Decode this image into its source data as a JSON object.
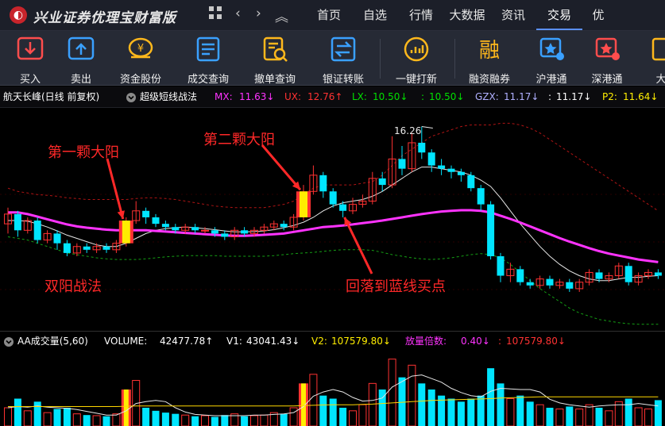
{
  "app": {
    "title": "兴业证券优理宝财富版"
  },
  "nav": {
    "grid_icon": "grid-icon",
    "back": "‹",
    "forward": "›",
    "collapse": "︽"
  },
  "tabs": [
    {
      "label": "首页"
    },
    {
      "label": "自选"
    },
    {
      "label": "行情"
    },
    {
      "label": "大数据"
    },
    {
      "label": "资讯"
    },
    {
      "label": "交易"
    },
    {
      "label": "优"
    }
  ],
  "active_tab": "交易",
  "toolbar": [
    {
      "label": "买入",
      "icon": "buy-icon",
      "color": "#ff4d4d"
    },
    {
      "label": "卖出",
      "icon": "sell-icon",
      "color": "#3aa0ff"
    },
    {
      "label": "资金股份",
      "icon": "fund-icon",
      "color": "#ffb81c"
    },
    {
      "label": "成交查询",
      "icon": "deal-query-icon",
      "color": "#3aa0ff"
    },
    {
      "label": "撤单查询",
      "icon": "cancel-query-icon",
      "color": "#ffb81c"
    },
    {
      "label": "银证转账",
      "icon": "transfer-icon",
      "color": "#3aa0ff"
    },
    {
      "label": "一键打新",
      "icon": "ipo-icon",
      "color": "#ffb81c"
    },
    {
      "label": "融资融券",
      "icon": "margin-icon",
      "color": "#ffb81c"
    },
    {
      "label": "沪港通",
      "icon": "sh-hk-icon",
      "color": "#3aa0ff"
    },
    {
      "label": "深港通",
      "icon": "sz-hk-icon",
      "color": "#ff4d4d"
    },
    {
      "label": "大",
      "icon": "more-icon",
      "color": "#ffb81c"
    }
  ],
  "price_info": {
    "stock": "航天长峰(日线 前复权)",
    "indicator": "超级短线战法",
    "mx_label": "MX: ",
    "mx_value": "11.63↓",
    "ux_label": "UX: ",
    "ux_value": "12.76↑",
    "lx_label": "LX: ",
    "lx_value": "10.50↓",
    "blank1_label": ": ",
    "blank1_value": "10.50↓",
    "gzx_label": "GZX: ",
    "gzx_value": "11.17↓",
    "blank2_label": ": ",
    "blank2_value": "11.17↓",
    "p2_label": "P2: ",
    "p2_value": "11.64↓"
  },
  "volume_info": {
    "name": "AA成交量(5,60)",
    "volume_label": "VOLUME: ",
    "volume_value": "42477.78↑",
    "v1_label": "V1: ",
    "v1_value": "43041.43↓",
    "v2_label": "V2: ",
    "v2_value": "107579.80↓",
    "ratio_label": "放量倍数: ",
    "ratio_value": "0.40↓",
    "blank_label": ": ",
    "blank_value": "107579.80↓"
  },
  "annotations": {
    "first": "第一颗大阳",
    "second": "第二颗大阳",
    "method": "双阳战法",
    "pullback": "回落到蓝线买点",
    "high_price": "16.26"
  },
  "colors": {
    "up": "#ff3232",
    "down": "#00e5ff",
    "highlight": "#ffee00",
    "mid_line": "#ff33ff",
    "upper_band": "#b01414",
    "lower_band": "#14a014",
    "white_line": "#e6e6e6",
    "v2_line": "#ffd700",
    "annotation": "#ff2828"
  },
  "chart_data": {
    "type": "candlestick",
    "bars": [
      {
        "o": 11.8,
        "c": 12.1,
        "h": 12.3,
        "l": 11.5,
        "v": 30000
      },
      {
        "o": 12.1,
        "c": 11.6,
        "h": 12.2,
        "l": 11.4,
        "v": 45000
      },
      {
        "o": 11.6,
        "c": 11.9,
        "h": 12.0,
        "l": 11.5,
        "v": 25000
      },
      {
        "o": 11.9,
        "c": 11.3,
        "h": 12.0,
        "l": 11.2,
        "v": 40000
      },
      {
        "o": 11.3,
        "c": 11.5,
        "h": 11.6,
        "l": 11.2,
        "v": 22000
      },
      {
        "o": 11.5,
        "c": 11.2,
        "h": 11.6,
        "l": 11.0,
        "v": 28000
      },
      {
        "o": 11.2,
        "c": 10.9,
        "h": 11.3,
        "l": 10.8,
        "v": 30000
      },
      {
        "o": 10.9,
        "c": 11.1,
        "h": 11.2,
        "l": 10.8,
        "v": 20000
      },
      {
        "o": 11.1,
        "c": 11.0,
        "h": 11.2,
        "l": 10.9,
        "v": 18000
      },
      {
        "o": 11.0,
        "c": 11.1,
        "h": 11.2,
        "l": 10.9,
        "v": 17000
      },
      {
        "o": 11.1,
        "c": 11.0,
        "h": 11.2,
        "l": 10.9,
        "v": 16000
      },
      {
        "o": 11.0,
        "c": 11.2,
        "h": 11.3,
        "l": 10.9,
        "v": 20000
      },
      {
        "o": 11.2,
        "c": 11.9,
        "h": 12.0,
        "l": 11.1,
        "v": 60000,
        "mark": true
      },
      {
        "o": 11.9,
        "c": 12.2,
        "h": 12.5,
        "l": 11.8,
        "v": 75000
      },
      {
        "o": 12.2,
        "c": 12.0,
        "h": 12.3,
        "l": 11.8,
        "v": 30000
      },
      {
        "o": 12.0,
        "c": 11.8,
        "h": 12.1,
        "l": 11.7,
        "v": 25000
      },
      {
        "o": 11.8,
        "c": 11.7,
        "h": 11.9,
        "l": 11.6,
        "v": 22000
      },
      {
        "o": 11.7,
        "c": 11.6,
        "h": 11.8,
        "l": 11.5,
        "v": 20000
      },
      {
        "o": 11.6,
        "c": 11.7,
        "h": 11.8,
        "l": 11.5,
        "v": 18000
      },
      {
        "o": 11.7,
        "c": 11.6,
        "h": 11.8,
        "l": 11.5,
        "v": 16000
      },
      {
        "o": 11.6,
        "c": 11.6,
        "h": 11.7,
        "l": 11.5,
        "v": 17000
      },
      {
        "o": 11.6,
        "c": 11.5,
        "h": 11.7,
        "l": 11.4,
        "v": 15000
      },
      {
        "o": 11.5,
        "c": 11.4,
        "h": 11.6,
        "l": 11.3,
        "v": 18000
      },
      {
        "o": 11.4,
        "c": 11.6,
        "h": 11.7,
        "l": 11.3,
        "v": 20000
      },
      {
        "o": 11.6,
        "c": 11.5,
        "h": 11.7,
        "l": 11.4,
        "v": 16000
      },
      {
        "o": 11.5,
        "c": 11.6,
        "h": 11.7,
        "l": 11.4,
        "v": 17000
      },
      {
        "o": 11.6,
        "c": 11.7,
        "h": 11.8,
        "l": 11.5,
        "v": 18000
      },
      {
        "o": 11.7,
        "c": 11.8,
        "h": 11.9,
        "l": 11.6,
        "v": 22000
      },
      {
        "o": 11.8,
        "c": 11.7,
        "h": 11.9,
        "l": 11.6,
        "v": 20000
      },
      {
        "o": 11.7,
        "c": 12.0,
        "h": 12.1,
        "l": 11.6,
        "v": 30000
      },
      {
        "o": 12.0,
        "c": 12.8,
        "h": 13.0,
        "l": 11.9,
        "v": 70000,
        "mark": true
      },
      {
        "o": 12.8,
        "c": 13.3,
        "h": 13.6,
        "l": 12.7,
        "v": 85000
      },
      {
        "o": 13.3,
        "c": 12.8,
        "h": 13.4,
        "l": 12.6,
        "v": 50000
      },
      {
        "o": 12.8,
        "c": 12.4,
        "h": 12.9,
        "l": 12.3,
        "v": 45000
      },
      {
        "o": 12.4,
        "c": 12.2,
        "h": 12.5,
        "l": 12.0,
        "v": 30000
      },
      {
        "o": 12.2,
        "c": 12.4,
        "h": 12.6,
        "l": 12.1,
        "v": 25000
      },
      {
        "o": 12.4,
        "c": 12.5,
        "h": 12.7,
        "l": 12.3,
        "v": 35000
      },
      {
        "o": 12.5,
        "c": 13.2,
        "h": 13.4,
        "l": 12.4,
        "v": 70000
      },
      {
        "o": 13.2,
        "c": 13.0,
        "h": 13.4,
        "l": 12.8,
        "v": 60000
      },
      {
        "o": 13.0,
        "c": 13.8,
        "h": 14.5,
        "l": 12.9,
        "v": 110000
      },
      {
        "o": 13.8,
        "c": 13.5,
        "h": 14.2,
        "l": 13.3,
        "v": 80000
      },
      {
        "o": 13.5,
        "c": 14.3,
        "h": 14.6,
        "l": 13.4,
        "v": 100000
      },
      {
        "o": 14.3,
        "c": 14.0,
        "h": 14.8,
        "l": 13.8,
        "v": 70000
      },
      {
        "o": 14.0,
        "c": 13.6,
        "h": 14.1,
        "l": 13.4,
        "v": 60000
      },
      {
        "o": 13.6,
        "c": 13.5,
        "h": 13.8,
        "l": 13.3,
        "v": 50000
      },
      {
        "o": 13.5,
        "c": 13.4,
        "h": 13.6,
        "l": 13.2,
        "v": 45000
      },
      {
        "o": 13.4,
        "c": 13.3,
        "h": 13.5,
        "l": 13.1,
        "v": 40000
      },
      {
        "o": 13.3,
        "c": 12.9,
        "h": 13.4,
        "l": 12.8,
        "v": 45000
      },
      {
        "o": 12.9,
        "c": 12.4,
        "h": 13.0,
        "l": 12.2,
        "v": 50000
      },
      {
        "o": 12.4,
        "c": 10.8,
        "h": 12.5,
        "l": 10.7,
        "v": 95000
      },
      {
        "o": 10.8,
        "c": 10.2,
        "h": 10.9,
        "l": 10.0,
        "v": 70000
      },
      {
        "o": 10.2,
        "c": 10.4,
        "h": 10.6,
        "l": 10.0,
        "v": 45000
      },
      {
        "o": 10.4,
        "c": 10.0,
        "h": 10.5,
        "l": 9.9,
        "v": 50000
      },
      {
        "o": 10.0,
        "c": 9.9,
        "h": 10.1,
        "l": 9.8,
        "v": 40000
      },
      {
        "o": 9.9,
        "c": 10.1,
        "h": 10.2,
        "l": 9.8,
        "v": 35000
      },
      {
        "o": 10.1,
        "c": 9.9,
        "h": 10.2,
        "l": 9.8,
        "v": 30000
      },
      {
        "o": 9.9,
        "c": 10.0,
        "h": 10.1,
        "l": 9.8,
        "v": 28000
      },
      {
        "o": 10.0,
        "c": 9.8,
        "h": 10.1,
        "l": 9.7,
        "v": 32000
      },
      {
        "o": 9.8,
        "c": 10.0,
        "h": 10.1,
        "l": 9.7,
        "v": 28000
      },
      {
        "o": 10.0,
        "c": 10.3,
        "h": 10.4,
        "l": 9.9,
        "v": 35000
      },
      {
        "o": 10.3,
        "c": 10.1,
        "h": 10.4,
        "l": 10.0,
        "v": 30000
      },
      {
        "o": 10.1,
        "c": 10.2,
        "h": 10.3,
        "l": 10.0,
        "v": 25000
      },
      {
        "o": 10.2,
        "c": 10.5,
        "h": 10.6,
        "l": 10.1,
        "v": 40000
      },
      {
        "o": 10.5,
        "c": 10.0,
        "h": 10.6,
        "l": 9.9,
        "v": 45000
      },
      {
        "o": 10.0,
        "c": 10.2,
        "h": 10.3,
        "l": 9.9,
        "v": 30000
      },
      {
        "o": 10.2,
        "c": 10.3,
        "h": 10.4,
        "l": 10.1,
        "v": 28000
      },
      {
        "o": 10.3,
        "c": 10.2,
        "h": 10.4,
        "l": 10.1,
        "v": 42478
      }
    ],
    "mid_line": [
      12.15,
      12.15,
      12.1,
      12.02,
      11.94,
      11.86,
      11.78,
      11.72,
      11.68,
      11.65,
      11.62,
      11.6,
      11.6,
      11.6,
      11.6,
      11.58,
      11.56,
      11.54,
      11.52,
      11.5,
      11.48,
      11.46,
      11.44,
      11.43,
      11.43,
      11.44,
      11.46,
      11.48,
      11.5,
      11.55,
      11.6,
      11.65,
      11.7,
      11.72,
      11.75,
      11.78,
      11.82,
      11.86,
      11.9,
      11.95,
      12.0,
      12.05,
      12.1,
      12.14,
      12.18,
      12.2,
      12.22,
      12.22,
      12.2,
      12.15,
      12.05,
      11.95,
      11.84,
      11.72,
      11.6,
      11.48,
      11.36,
      11.25,
      11.15,
      11.05,
      10.96,
      10.88,
      10.82,
      10.76,
      10.7,
      10.66,
      10.62
    ],
    "upper_band": [
      12.9,
      12.8,
      12.75,
      12.7,
      12.68,
      12.65,
      12.6,
      12.58,
      12.55,
      12.55,
      12.55,
      12.55,
      12.55,
      12.58,
      12.6,
      12.6,
      12.58,
      12.55,
      12.5,
      12.45,
      12.4,
      12.35,
      12.32,
      12.3,
      12.3,
      12.3,
      12.3,
      12.35,
      12.4,
      12.5,
      12.7,
      12.9,
      13.0,
      13.0,
      13.0,
      13.0,
      13.05,
      13.1,
      13.3,
      13.6,
      13.9,
      14.1,
      14.3,
      14.5,
      14.6,
      14.7,
      14.8,
      14.85,
      14.85,
      14.85,
      14.9,
      14.9,
      14.85,
      14.75,
      14.6,
      14.4,
      14.2,
      14.0,
      13.8,
      13.6,
      13.4,
      13.2,
      13.0,
      12.8,
      12.6,
      12.4,
      12.2
    ],
    "lower_band": [
      11.4,
      11.35,
      11.3,
      11.2,
      11.1,
      11.0,
      10.9,
      10.85,
      10.8,
      10.75,
      10.72,
      10.7,
      10.7,
      10.7,
      10.72,
      10.75,
      10.78,
      10.8,
      10.82,
      10.82,
      10.82,
      10.82,
      10.8,
      10.8,
      10.8,
      10.8,
      10.8,
      10.82,
      10.85,
      10.88,
      10.9,
      10.92,
      10.95,
      10.98,
      11.0,
      11.0,
      11.0,
      10.98,
      10.92,
      10.85,
      10.8,
      10.75,
      10.72,
      10.7,
      10.72,
      10.75,
      10.8,
      10.85,
      10.88,
      10.85,
      10.75,
      10.55,
      10.3,
      10.05,
      9.8,
      9.6,
      9.4,
      9.2,
      9.05,
      8.95,
      8.85,
      8.8,
      8.75,
      8.72,
      8.7,
      8.7,
      8.7
    ],
    "white_line": [
      11.9,
      11.9,
      11.88,
      11.8,
      11.7,
      11.58,
      11.45,
      11.35,
      11.25,
      11.15,
      11.1,
      11.1,
      11.2,
      11.35,
      11.5,
      11.6,
      11.65,
      11.68,
      11.7,
      11.68,
      11.65,
      11.62,
      11.58,
      11.55,
      11.55,
      11.56,
      11.58,
      11.62,
      11.68,
      11.75,
      11.85,
      12.0,
      12.2,
      12.35,
      12.45,
      12.5,
      12.55,
      12.65,
      12.8,
      13.0,
      13.2,
      13.4,
      13.55,
      13.55,
      13.5,
      13.45,
      13.4,
      13.3,
      13.15,
      12.95,
      12.6,
      12.2,
      11.8,
      11.45,
      11.1,
      10.8,
      10.55,
      10.35,
      10.2,
      10.1,
      10.05,
      10.05,
      10.1,
      10.15,
      10.15,
      10.18,
      10.2
    ],
    "v1_line": [
      30000,
      32000,
      31000,
      33000,
      31000,
      30000,
      29000,
      27000,
      24000,
      21000,
      18000,
      18000,
      25000,
      37000,
      40000,
      42000,
      40000,
      30000,
      23000,
      19000,
      18000,
      17000,
      17000,
      17000,
      17000,
      18000,
      18000,
      19000,
      20000,
      22000,
      32000,
      49000,
      56000,
      60000,
      56000,
      47000,
      41000,
      42000,
      46000,
      64000,
      73000,
      82000,
      84000,
      78000,
      72000,
      62000,
      55000,
      50000,
      48000,
      57000,
      62000,
      61000,
      60000,
      60000,
      56000,
      44000,
      38000,
      35000,
      33000,
      31000,
      33000,
      34000,
      35000,
      35000,
      37000,
      35000,
      33000
    ],
    "v2_line": [
      32000,
      32000,
      32000,
      32000,
      32000,
      32000,
      32000,
      32000,
      32000,
      32000,
      32000,
      32000,
      32500,
      33000,
      33000,
      33000,
      33000,
      33000,
      33000,
      33000,
      33000,
      33000,
      33000,
      33000,
      33000,
      33000,
      33000,
      33000,
      33000,
      33000,
      33500,
      34000,
      34500,
      35000,
      35000,
      35000,
      35500,
      36000,
      37000,
      38000,
      39000,
      40000,
      41000,
      42000,
      42500,
      43000,
      43500,
      44000,
      44500,
      45000,
      46000,
      46500,
      47000,
      47500,
      48000,
      48000,
      48000,
      48000,
      48000,
      48000,
      48000,
      48000,
      48000,
      48000,
      48000,
      48000,
      48000
    ]
  }
}
